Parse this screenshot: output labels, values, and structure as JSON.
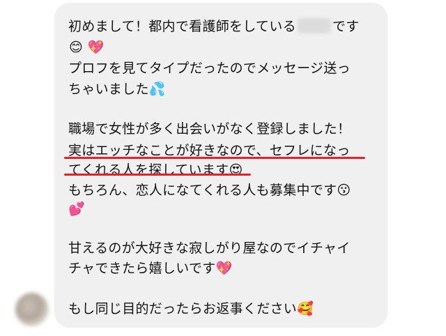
{
  "message": {
    "line1_prefix": "初めまして！都内で看護師をしている",
    "line1_suffix": "です",
    "line2_emojis": "😊 💖",
    "line3": "プロフを見てタイプだったのでメッセージ送っ",
    "line4": "ちゃいました💦",
    "line5": "職場で女性が多く出会いがなく登録しました！",
    "line6": "実はエッチなことが好きなので、セフレになっ",
    "line7": "てくれる人を探しています😍",
    "line8": "もちろん、恋人になてくれる人も募集中です😗",
    "line9": "💕",
    "line10": "甘えるのが大好きな寂しがり屋なのでイチャイ",
    "line11": "チャできたら嬉しいです💖",
    "line12": "もし同じ目的だったらお返事ください🥰"
  },
  "colors": {
    "bubble": "#f0f0f0",
    "text": "#141414",
    "underline": "#e8202a"
  }
}
